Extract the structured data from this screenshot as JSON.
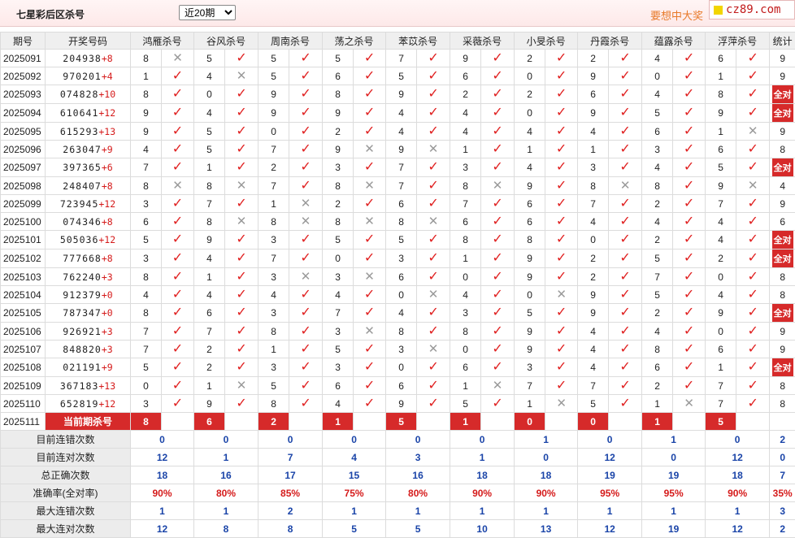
{
  "title": "七星彩后区杀号",
  "range_select": {
    "value": "近20期",
    "options": [
      "近20期"
    ]
  },
  "promo": "要想中大奖",
  "logo": "cz89.com",
  "headers": [
    "期号",
    "开奖号码",
    "鸿雁杀号",
    "谷风杀号",
    "周南杀号",
    "荡之杀号",
    "苯苡杀号",
    "采薇杀号",
    "小旻杀号",
    "丹霞杀号",
    "蕴露杀号",
    "浮萍杀号",
    "统计"
  ],
  "rows": [
    {
      "issue": "2025091",
      "draw": "204938",
      "extra": "+8",
      "kills": [
        [
          8,
          false
        ],
        [
          5,
          true
        ],
        [
          5,
          true
        ],
        [
          5,
          true
        ],
        [
          7,
          true
        ],
        [
          9,
          true
        ],
        [
          2,
          true
        ],
        [
          2,
          true
        ],
        [
          4,
          true
        ],
        [
          6,
          true
        ]
      ],
      "count": "9"
    },
    {
      "issue": "2025092",
      "draw": "970201",
      "extra": "+4",
      "kills": [
        [
          1,
          true
        ],
        [
          4,
          false
        ],
        [
          5,
          true
        ],
        [
          6,
          true
        ],
        [
          5,
          true
        ],
        [
          6,
          true
        ],
        [
          0,
          true
        ],
        [
          9,
          true
        ],
        [
          0,
          true
        ],
        [
          1,
          true
        ]
      ],
      "count": "9"
    },
    {
      "issue": "2025093",
      "draw": "074828",
      "extra": "+10",
      "kills": [
        [
          8,
          true
        ],
        [
          0,
          true
        ],
        [
          9,
          true
        ],
        [
          8,
          true
        ],
        [
          9,
          true
        ],
        [
          2,
          true
        ],
        [
          2,
          true
        ],
        [
          6,
          true
        ],
        [
          4,
          true
        ],
        [
          8,
          true
        ]
      ],
      "count": "全对"
    },
    {
      "issue": "2025094",
      "draw": "610641",
      "extra": "+12",
      "kills": [
        [
          9,
          true
        ],
        [
          4,
          true
        ],
        [
          9,
          true
        ],
        [
          9,
          true
        ],
        [
          4,
          true
        ],
        [
          4,
          true
        ],
        [
          0,
          true
        ],
        [
          9,
          true
        ],
        [
          5,
          true
        ],
        [
          9,
          true
        ]
      ],
      "count": "全对"
    },
    {
      "issue": "2025095",
      "draw": "615293",
      "extra": "+13",
      "kills": [
        [
          9,
          true
        ],
        [
          5,
          true
        ],
        [
          0,
          true
        ],
        [
          2,
          true
        ],
        [
          4,
          true
        ],
        [
          4,
          true
        ],
        [
          4,
          true
        ],
        [
          4,
          true
        ],
        [
          6,
          true
        ],
        [
          1,
          false
        ]
      ],
      "count": "9"
    },
    {
      "issue": "2025096",
      "draw": "263047",
      "extra": "+9",
      "kills": [
        [
          4,
          true
        ],
        [
          5,
          true
        ],
        [
          7,
          true
        ],
        [
          9,
          false
        ],
        [
          9,
          false
        ],
        [
          1,
          true
        ],
        [
          1,
          true
        ],
        [
          1,
          true
        ],
        [
          3,
          true
        ],
        [
          6,
          true
        ]
      ],
      "count": "8"
    },
    {
      "issue": "2025097",
      "draw": "397365",
      "extra": "+6",
      "kills": [
        [
          7,
          true
        ],
        [
          1,
          true
        ],
        [
          2,
          true
        ],
        [
          3,
          true
        ],
        [
          7,
          true
        ],
        [
          3,
          true
        ],
        [
          4,
          true
        ],
        [
          3,
          true
        ],
        [
          4,
          true
        ],
        [
          5,
          true
        ]
      ],
      "count": "全对"
    },
    {
      "issue": "2025098",
      "draw": "248407",
      "extra": "+8",
      "kills": [
        [
          8,
          false
        ],
        [
          8,
          false
        ],
        [
          7,
          true
        ],
        [
          8,
          false
        ],
        [
          7,
          true
        ],
        [
          8,
          false
        ],
        [
          9,
          true
        ],
        [
          8,
          false
        ],
        [
          8,
          true
        ],
        [
          9,
          false
        ]
      ],
      "count": "4"
    },
    {
      "issue": "2025099",
      "draw": "723945",
      "extra": "+12",
      "kills": [
        [
          3,
          true
        ],
        [
          7,
          true
        ],
        [
          1,
          false
        ],
        [
          2,
          true
        ],
        [
          6,
          true
        ],
        [
          7,
          true
        ],
        [
          6,
          true
        ],
        [
          7,
          true
        ],
        [
          2,
          true
        ],
        [
          7,
          true
        ]
      ],
      "count": "9"
    },
    {
      "issue": "2025100",
      "draw": "074346",
      "extra": "+8",
      "kills": [
        [
          6,
          true
        ],
        [
          8,
          false
        ],
        [
          8,
          false
        ],
        [
          8,
          false
        ],
        [
          8,
          false
        ],
        [
          6,
          true
        ],
        [
          6,
          true
        ],
        [
          4,
          true
        ],
        [
          4,
          true
        ],
        [
          4,
          true
        ]
      ],
      "count": "6"
    },
    {
      "issue": "2025101",
      "draw": "505036",
      "extra": "+12",
      "kills": [
        [
          5,
          true
        ],
        [
          9,
          true
        ],
        [
          3,
          true
        ],
        [
          5,
          true
        ],
        [
          5,
          true
        ],
        [
          8,
          true
        ],
        [
          8,
          true
        ],
        [
          0,
          true
        ],
        [
          2,
          true
        ],
        [
          4,
          true
        ]
      ],
      "count": "全对"
    },
    {
      "issue": "2025102",
      "draw": "777668",
      "extra": "+8",
      "kills": [
        [
          3,
          true
        ],
        [
          4,
          true
        ],
        [
          7,
          true
        ],
        [
          0,
          true
        ],
        [
          3,
          true
        ],
        [
          1,
          true
        ],
        [
          9,
          true
        ],
        [
          2,
          true
        ],
        [
          5,
          true
        ],
        [
          2,
          true
        ]
      ],
      "count": "全对"
    },
    {
      "issue": "2025103",
      "draw": "762240",
      "extra": "+3",
      "kills": [
        [
          8,
          true
        ],
        [
          1,
          true
        ],
        [
          3,
          false
        ],
        [
          3,
          false
        ],
        [
          6,
          true
        ],
        [
          0,
          true
        ],
        [
          9,
          true
        ],
        [
          2,
          true
        ],
        [
          7,
          true
        ],
        [
          0,
          true
        ]
      ],
      "count": "8"
    },
    {
      "issue": "2025104",
      "draw": "912379",
      "extra": "+0",
      "kills": [
        [
          4,
          true
        ],
        [
          4,
          true
        ],
        [
          4,
          true
        ],
        [
          4,
          true
        ],
        [
          0,
          false
        ],
        [
          4,
          true
        ],
        [
          0,
          false
        ],
        [
          9,
          true
        ],
        [
          5,
          true
        ],
        [
          4,
          true
        ]
      ],
      "count": "8"
    },
    {
      "issue": "2025105",
      "draw": "787347",
      "extra": "+0",
      "kills": [
        [
          8,
          true
        ],
        [
          6,
          true
        ],
        [
          3,
          true
        ],
        [
          7,
          true
        ],
        [
          4,
          true
        ],
        [
          3,
          true
        ],
        [
          5,
          true
        ],
        [
          9,
          true
        ],
        [
          2,
          true
        ],
        [
          9,
          true
        ]
      ],
      "count": "全对"
    },
    {
      "issue": "2025106",
      "draw": "926921",
      "extra": "+3",
      "kills": [
        [
          7,
          true
        ],
        [
          7,
          true
        ],
        [
          8,
          true
        ],
        [
          3,
          false
        ],
        [
          8,
          true
        ],
        [
          8,
          true
        ],
        [
          9,
          true
        ],
        [
          4,
          true
        ],
        [
          4,
          true
        ],
        [
          0,
          true
        ]
      ],
      "count": "9"
    },
    {
      "issue": "2025107",
      "draw": "848820",
      "extra": "+3",
      "kills": [
        [
          7,
          true
        ],
        [
          2,
          true
        ],
        [
          1,
          true
        ],
        [
          5,
          true
        ],
        [
          3,
          false
        ],
        [
          0,
          true
        ],
        [
          9,
          true
        ],
        [
          4,
          true
        ],
        [
          8,
          true
        ],
        [
          6,
          true
        ]
      ],
      "count": "9"
    },
    {
      "issue": "2025108",
      "draw": "021191",
      "extra": "+9",
      "kills": [
        [
          5,
          true
        ],
        [
          2,
          true
        ],
        [
          3,
          true
        ],
        [
          3,
          true
        ],
        [
          0,
          true
        ],
        [
          6,
          true
        ],
        [
          3,
          true
        ],
        [
          4,
          true
        ],
        [
          6,
          true
        ],
        [
          1,
          true
        ]
      ],
      "count": "全对"
    },
    {
      "issue": "2025109",
      "draw": "367183",
      "extra": "+13",
      "kills": [
        [
          0,
          true
        ],
        [
          1,
          false
        ],
        [
          5,
          true
        ],
        [
          6,
          true
        ],
        [
          6,
          true
        ],
        [
          1,
          false
        ],
        [
          7,
          true
        ],
        [
          7,
          true
        ],
        [
          2,
          true
        ],
        [
          7,
          true
        ]
      ],
      "count": "8"
    },
    {
      "issue": "2025110",
      "draw": "652819",
      "extra": "+12",
      "kills": [
        [
          3,
          true
        ],
        [
          9,
          true
        ],
        [
          8,
          true
        ],
        [
          4,
          true
        ],
        [
          9,
          true
        ],
        [
          5,
          true
        ],
        [
          1,
          false
        ],
        [
          5,
          true
        ],
        [
          1,
          false
        ],
        [
          7,
          true
        ]
      ],
      "count": "8"
    }
  ],
  "current": {
    "issue": "2025111",
    "label": "当前期杀号",
    "kills": [
      "8",
      "6",
      "2",
      "1",
      "5",
      "1",
      "0",
      "0",
      "1",
      "5"
    ]
  },
  "stats": [
    {
      "label": "目前连错次数",
      "values": [
        "0",
        "0",
        "0",
        "0",
        "0",
        "0",
        "1",
        "0",
        "1",
        "0",
        "2"
      ]
    },
    {
      "label": "目前连对次数",
      "values": [
        "12",
        "1",
        "7",
        "4",
        "3",
        "1",
        "0",
        "12",
        "0",
        "12",
        "0"
      ]
    },
    {
      "label": "总正确次数",
      "values": [
        "18",
        "16",
        "17",
        "15",
        "16",
        "18",
        "18",
        "19",
        "19",
        "18",
        "7"
      ]
    },
    {
      "label": "准确率(全对率)",
      "values": [
        "90%",
        "80%",
        "85%",
        "75%",
        "80%",
        "90%",
        "90%",
        "95%",
        "95%",
        "90%",
        "35%"
      ]
    },
    {
      "label": "最大连错次数",
      "values": [
        "1",
        "1",
        "2",
        "1",
        "1",
        "1",
        "1",
        "1",
        "1",
        "1",
        "3"
      ]
    },
    {
      "label": "最大连对次数",
      "values": [
        "12",
        "8",
        "8",
        "5",
        "5",
        "10",
        "13",
        "12",
        "19",
        "12",
        "2"
      ]
    }
  ],
  "marks": {
    "correct": "✓",
    "wrong": "✕"
  },
  "colors": {
    "accent": "#d62a2a",
    "header_bg": "#efefef",
    "stat_blue": "#1a44a8"
  }
}
